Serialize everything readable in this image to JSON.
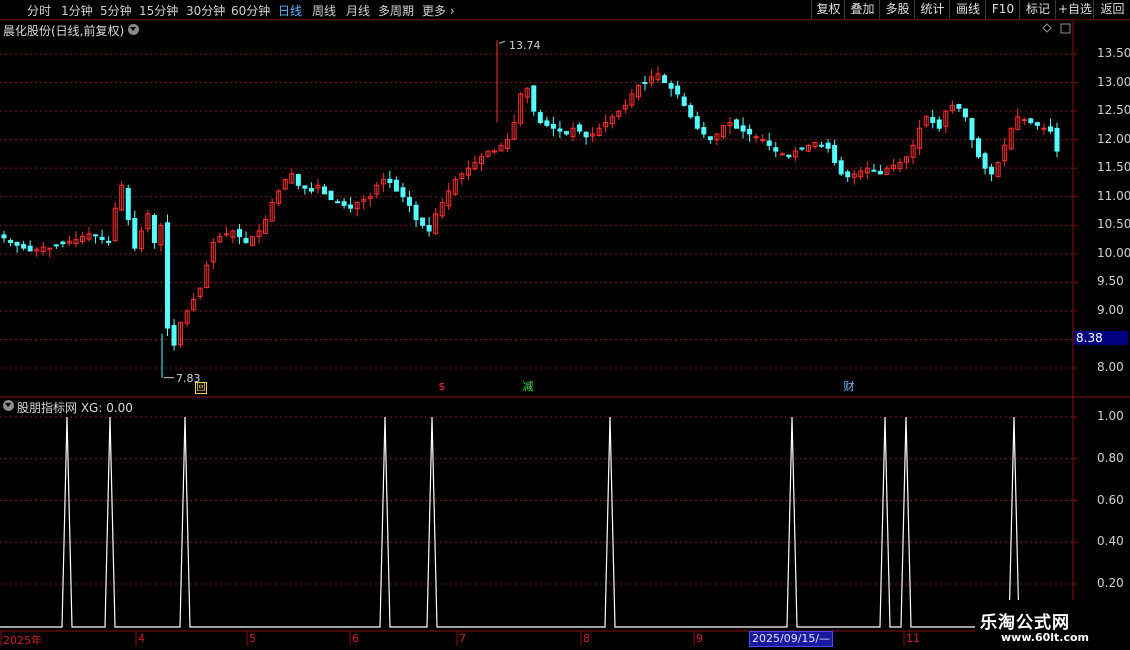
{
  "periods": [
    {
      "label": "分时",
      "active": false
    },
    {
      "label": "1分钟",
      "active": false
    },
    {
      "label": "5分钟",
      "active": false
    },
    {
      "label": "15分钟",
      "active": false
    },
    {
      "label": "30分钟",
      "active": false
    },
    {
      "label": "60分钟",
      "active": false
    },
    {
      "label": "日线",
      "active": true
    },
    {
      "label": "周线",
      "active": false
    },
    {
      "label": "月线",
      "active": false
    },
    {
      "label": "多周期",
      "active": false
    },
    {
      "label": "更多",
      "active": false
    }
  ],
  "toolbar_buttons": [
    "复权",
    "叠加",
    "多股",
    "统计",
    "画线",
    "F10",
    "标记",
    "+自选",
    "返回"
  ],
  "main_chart": {
    "title": "晨化股份(日线,前复权)",
    "y_axis_labels": [
      "13.50",
      "13.00",
      "12.50",
      "12.00",
      "11.50",
      "11.00",
      "10.50",
      "10.00",
      "9.50",
      "9.00",
      "8.50",
      "8.00"
    ],
    "current_price_tag": "8.38",
    "high_label": "13.74",
    "low_label": "7.83",
    "events": {
      "hui": "回",
      "dollar": "$",
      "jian": "减",
      "cai": "财"
    }
  },
  "indicator": {
    "title": "股朋指标网 XG: 0.00",
    "y_axis_labels": [
      "1.00",
      "0.80",
      "0.60",
      "0.40",
      "0.20"
    ]
  },
  "time_axis": {
    "labels": [
      "2025年",
      "4",
      "5",
      "6",
      "7",
      "8",
      "9",
      "11"
    ],
    "cursor_date": "2025/09/15/—"
  },
  "watermark": {
    "title": "乐淘公式网",
    "url": "www.60lt.com"
  },
  "colors": {
    "up": "#ff3030",
    "down": "#54ffff",
    "grid": "#7a1a1a",
    "axis": "#8a1010",
    "indicator_line": "#ffffff",
    "active_period": "#5ab4ff"
  },
  "chart_data": {
    "type": "candlestick",
    "price_range": [
      7.7,
      13.9
    ],
    "ohlc_approx": [
      10.28,
      10.2,
      10.15,
      10.1,
      10.05,
      10.08,
      10.12,
      10.1,
      10.15,
      10.18,
      10.22,
      10.25,
      10.3,
      10.35,
      10.32,
      10.25,
      10.2,
      10.8,
      11.2,
      10.6,
      10.1,
      10.4,
      10.7,
      10.2,
      10.5,
      8.7,
      8.4,
      8.8,
      9.0,
      9.2,
      9.4,
      9.8,
      10.2,
      10.3,
      10.35,
      10.4,
      10.3,
      10.2,
      10.3,
      10.4,
      10.6,
      10.9,
      11.1,
      11.3,
      11.4,
      11.2,
      11.15,
      11.1,
      11.2,
      11.05,
      10.95,
      10.9,
      10.85,
      10.8,
      10.9,
      10.95,
      11.0,
      11.2,
      11.3,
      11.25,
      11.1,
      11.0,
      10.85,
      10.6,
      10.5,
      10.4,
      10.7,
      10.9,
      11.1,
      11.3,
      11.4,
      11.5,
      11.6,
      11.7,
      11.8,
      11.8,
      11.9,
      12.0,
      12.3,
      12.8,
      12.9,
      12.5,
      12.3,
      12.25,
      12.2,
      12.15,
      12.1,
      12.2,
      12.15,
      12.05,
      12.1,
      12.2,
      12.3,
      12.4,
      12.5,
      12.6,
      12.8,
      12.95,
      13.0,
      13.1,
      13.15,
      13.0,
      12.9,
      12.8,
      12.6,
      12.4,
      12.2,
      12.1,
      12.0,
      12.1,
      12.25,
      12.3,
      12.2,
      12.15,
      12.1,
      12.05,
      12.0,
      11.9,
      11.8,
      11.75,
      11.7,
      11.8,
      11.85,
      11.9,
      11.95,
      11.9,
      11.85,
      11.6,
      11.4,
      11.35,
      11.4,
      11.45,
      11.5,
      11.45,
      11.4,
      11.5,
      11.55,
      11.6,
      11.7,
      11.9,
      12.2,
      12.4,
      12.3,
      12.2,
      12.5,
      12.6,
      12.55,
      12.4,
      12.0,
      11.7,
      11.5,
      11.4,
      11.6,
      11.9,
      12.2,
      12.4,
      12.35,
      12.3,
      12.25,
      12.2,
      12.15,
      11.8
    ],
    "indicator_xg_spikes": 11,
    "indicator_range": [
      0,
      1
    ]
  }
}
